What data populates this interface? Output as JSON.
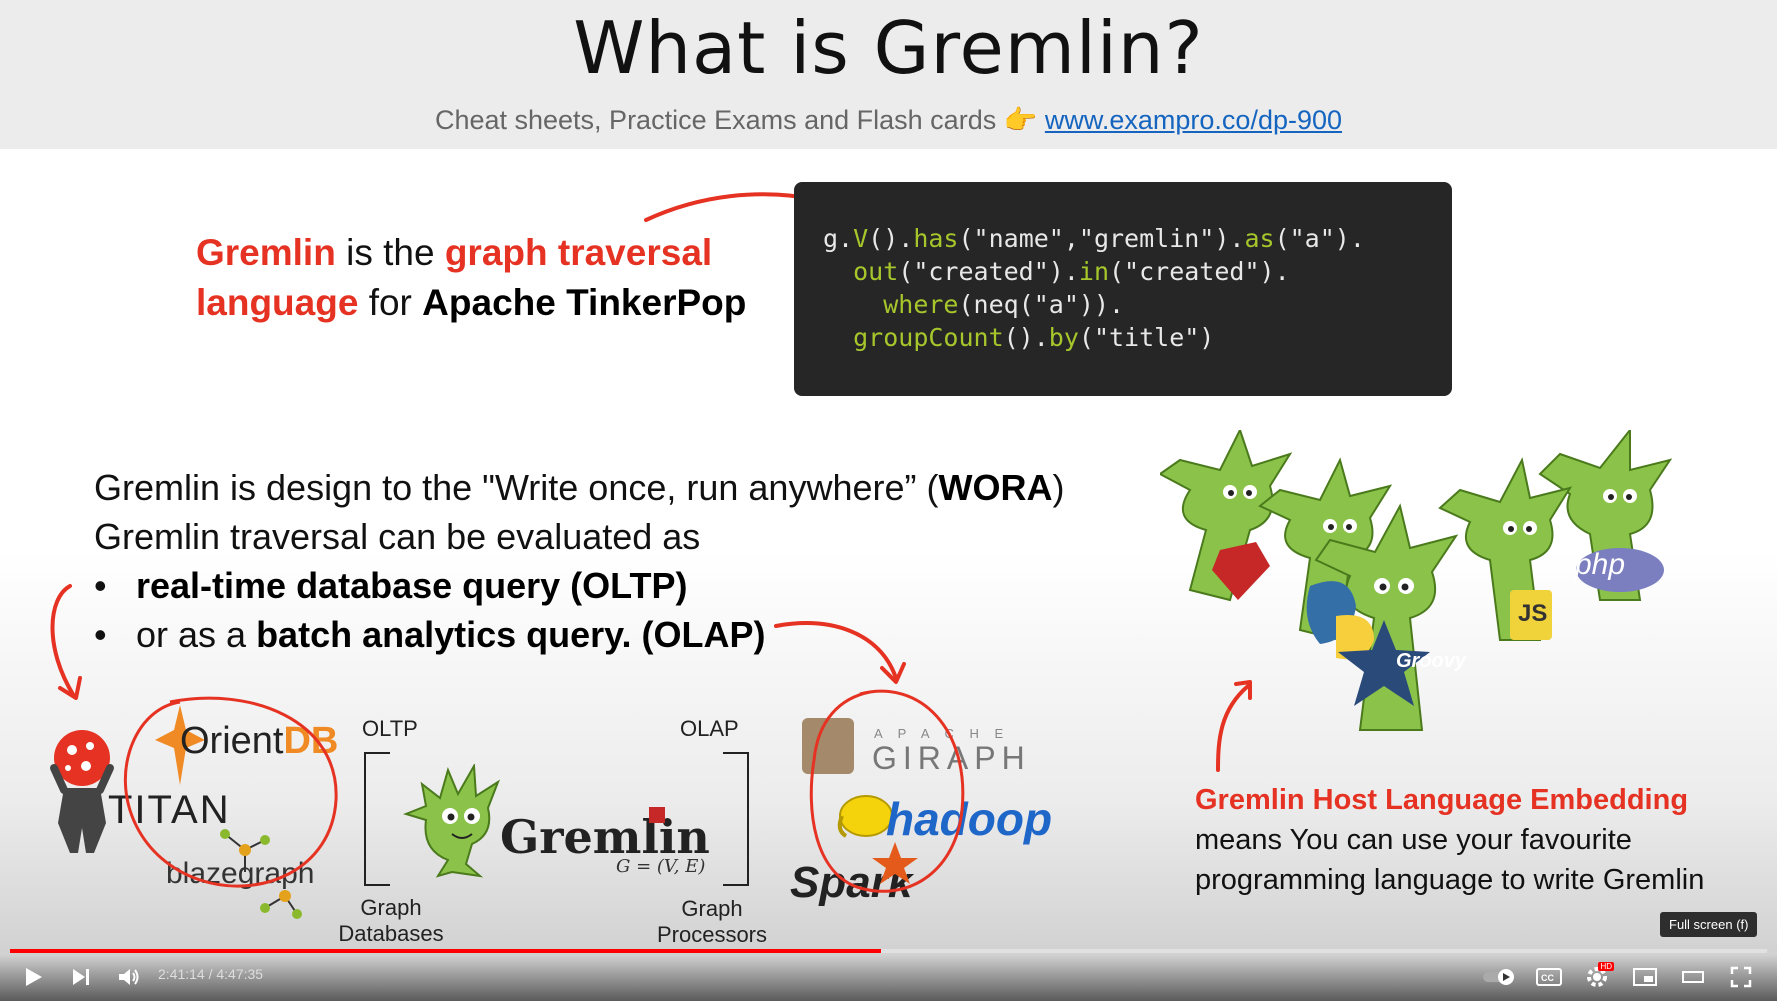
{
  "slide": {
    "title": "What is Gremlin?",
    "subtitle_text": "Cheat sheets, Practice Exams and Flash cards",
    "subtitle_emoji": "👉",
    "subtitle_link": "www.exampro.co/dp-900",
    "intro": {
      "gremlin": "Gremlin",
      "is_the": " is the ",
      "gtl1": "graph traversal",
      "gtl2": "language",
      "for": " for ",
      "apache": "Apache TinkerPop"
    },
    "code_lines": [
      "g.V().has(\"name\",\"gremlin\").as(\"a\").",
      "  out(\"created\").in(\"created\").",
      "    where(neq(\"a\")).",
      "  groupCount().by(\"title\")"
    ],
    "wora_line1_a": "Gremlin is design to the \"Write once, run anywhere” (",
    "wora_line1_b": "WORA",
    "wora_line1_c": ")",
    "wora_line2": "Gremlin traversal can be evaluated as",
    "bullet1": "real-time database query  (OLTP)",
    "bullet2_a": "or as a ",
    "bullet2_b": "batch analytics query. (OLAP)",
    "oltp_label": "OLTP",
    "olap_label": "OLAP",
    "graph_db_label_1": "Graph",
    "graph_db_label_2": "Databases",
    "graph_proc_label_1": "Graph",
    "graph_proc_label_2": "Processors",
    "logos": {
      "orientdb_a": "Orient",
      "orientdb_b": "DB",
      "titan": "TITAN",
      "blazegraph": "blazegraph",
      "gremlin": "Gremlin",
      "gremlin_formula": "G = (V, E)",
      "giraph_top": "A P A C H E",
      "giraph": "GIRAPH",
      "hadoop": "hadoop",
      "spark": "Spark",
      "php": "php",
      "js": "JS",
      "groovy": "Groovy"
    },
    "embed_heading": "Gremlin Host Language Embedding",
    "embed_line1": "means You can use your favourite",
    "embed_line2": "programming language to write Gremlin"
  },
  "player": {
    "time_display": "2:41:14 / 4:47:35",
    "progress_fraction": 0.4955,
    "tooltip": "Full screen (f)",
    "hd_badge": "HD",
    "accent": "#ff0000"
  }
}
